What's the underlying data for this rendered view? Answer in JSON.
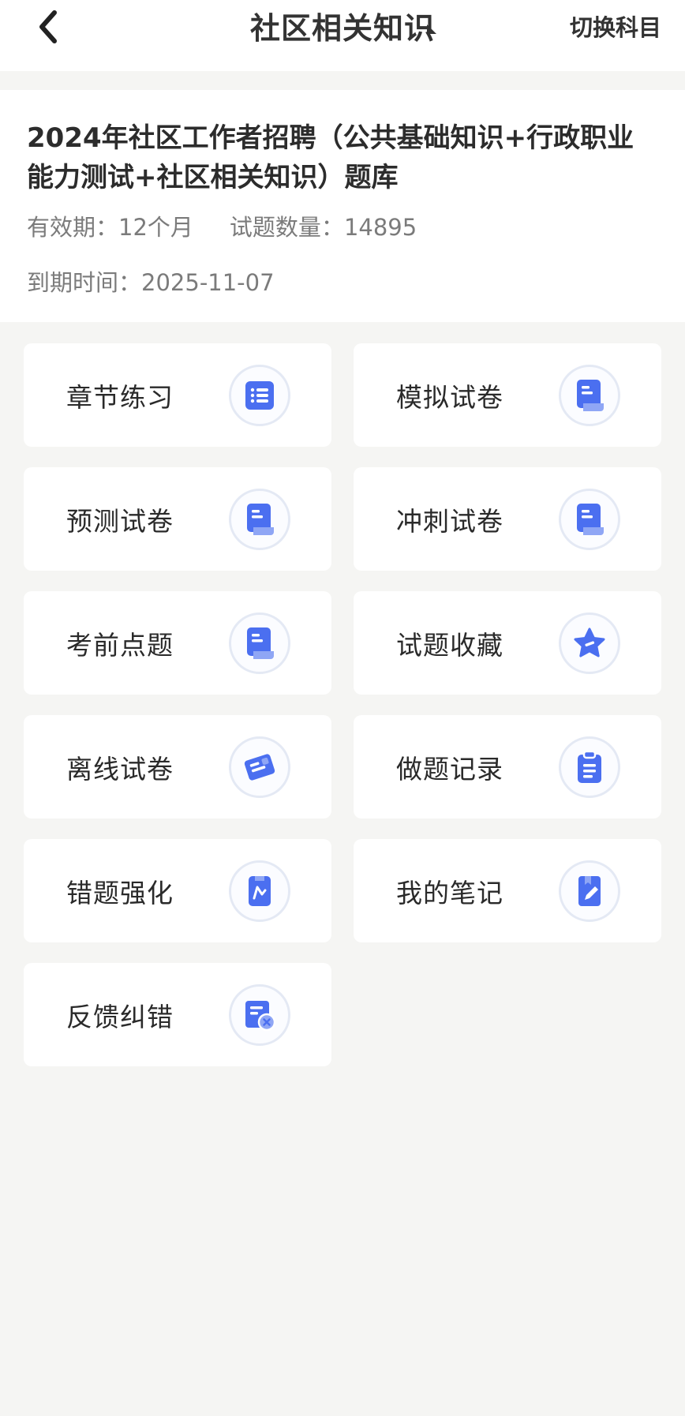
{
  "header": {
    "back_icon": "chevron-left-icon",
    "title": "社区相关知识",
    "switch_label": "切换科目"
  },
  "info": {
    "bank_title": "2024年社区工作者招聘（公共基础知识+行政职业能力测试+社区相关知识）题库",
    "validity_label": "有效期：",
    "validity_value": "12个月",
    "count_label": "试题数量：",
    "count_value": "14895",
    "expire_label": "到期时间：",
    "expire_value": "2025-11-07"
  },
  "colors": {
    "accent": "#4b6ff0",
    "accent_light": "#8fa6f5",
    "ring": "#e4e9f4"
  },
  "menu": [
    {
      "label": "章节练习",
      "icon": "list-icon"
    },
    {
      "label": "模拟试卷",
      "icon": "paper-scroll-icon"
    },
    {
      "label": "预测试卷",
      "icon": "paper-scroll-icon"
    },
    {
      "label": "冲刺试卷",
      "icon": "paper-scroll-icon"
    },
    {
      "label": "考前点题",
      "icon": "paper-scroll-icon"
    },
    {
      "label": "试题收藏",
      "icon": "star-icon"
    },
    {
      "label": "离线试卷",
      "icon": "download-paper-icon"
    },
    {
      "label": "做题记录",
      "icon": "clipboard-icon"
    },
    {
      "label": "错题强化",
      "icon": "mistake-book-icon"
    },
    {
      "label": "我的笔记",
      "icon": "note-pen-icon"
    },
    {
      "label": "反馈纠错",
      "icon": "feedback-error-icon"
    }
  ]
}
